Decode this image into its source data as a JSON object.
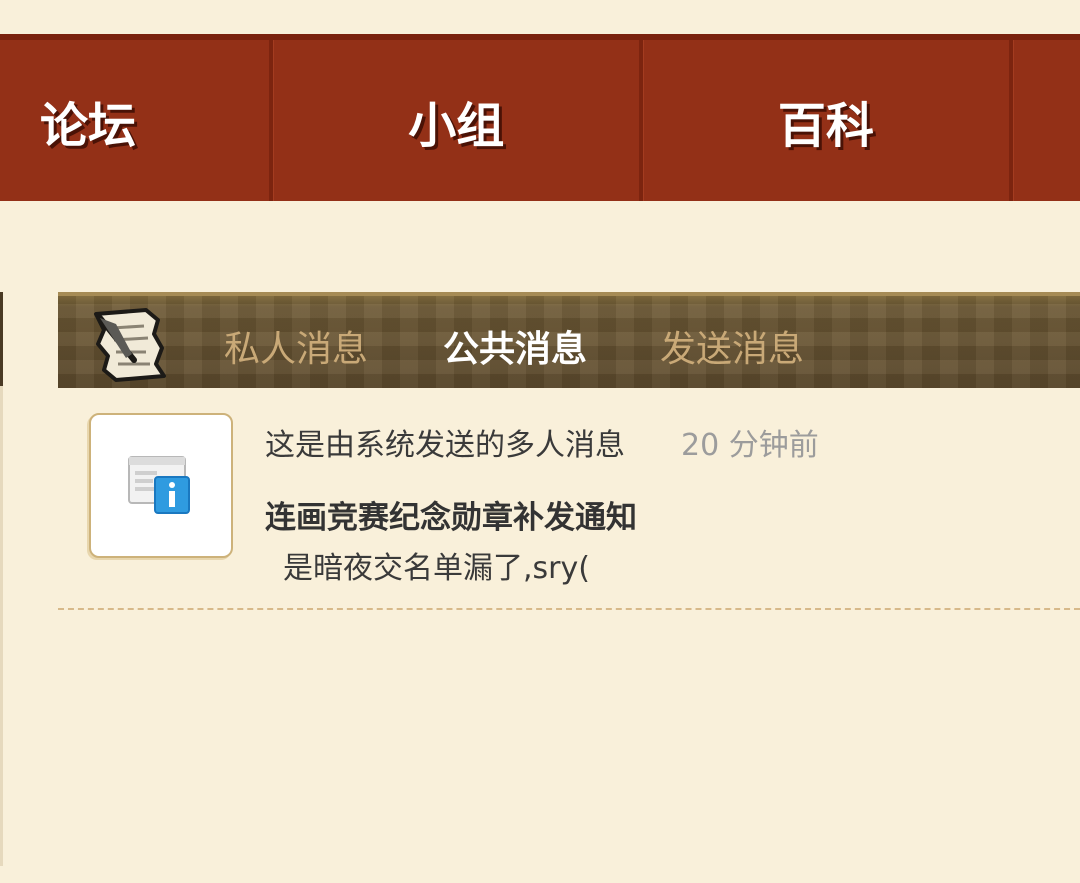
{
  "nav": {
    "items": [
      {
        "label": "论坛"
      },
      {
        "label": "小组"
      },
      {
        "label": "百科"
      }
    ]
  },
  "tabs": {
    "private": "私人消息",
    "public": "公共消息",
    "send": "发送消息",
    "active": "public"
  },
  "message": {
    "sender": "这是由系统发送的多人消息",
    "time": "20 分钟前",
    "title": "连画竞赛纪念勋章补发通知",
    "body": "是暗夜交名单漏了,sry("
  },
  "icons": {
    "tab_logo": "scroll-quill-icon",
    "message_icon": "info-window-icon"
  },
  "colors": {
    "nav_bg": "#933017",
    "page_bg": "#f9f0da",
    "tab_inactive": "#c9a977",
    "tab_active": "#ffffff"
  }
}
